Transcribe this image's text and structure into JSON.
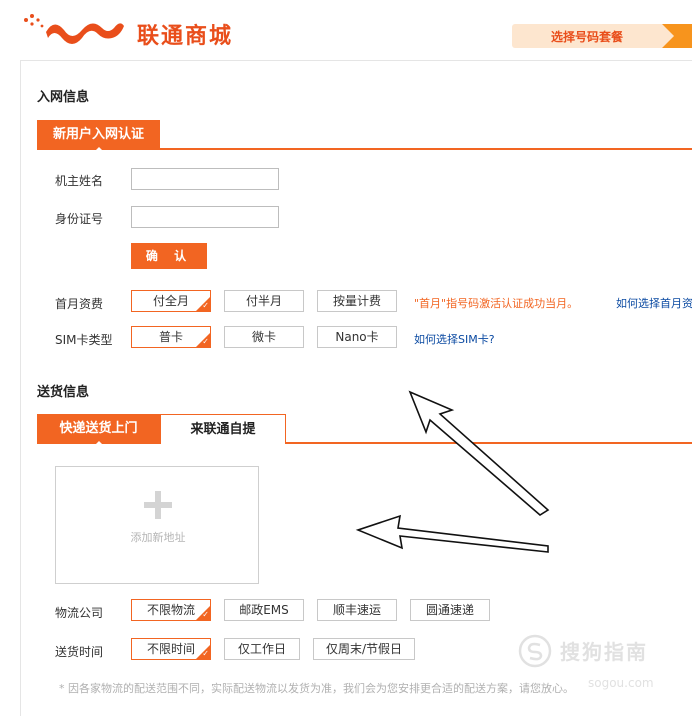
{
  "header": {
    "logo_text": "联通商城",
    "step_label": "选择号码套餐",
    "brand_color": "#e94e1b"
  },
  "network_section": {
    "title": "入网信息",
    "tab_label": "新用户入网认证",
    "owner_name_label": "机主姓名",
    "owner_name_value": "",
    "id_number_label": "身份证号",
    "id_number_value": "",
    "confirm_label": "确 认",
    "first_month_label": "首月资费",
    "first_month_options": [
      "付全月",
      "付半月",
      "按量计费"
    ],
    "first_month_selected": "付全月",
    "first_month_note": "\"首月\"指号码激活认证成功当月。",
    "first_month_help": "如何选择首月资",
    "sim_label": "SIM卡类型",
    "sim_options": [
      "普卡",
      "微卡",
      "Nano卡"
    ],
    "sim_selected": "普卡",
    "sim_help": "如何选择SIM卡?"
  },
  "delivery_section": {
    "title": "送货信息",
    "tabs": [
      "快递送货上门",
      "来联通自提"
    ],
    "active_tab": "快递送货上门",
    "add_address_label": "添加新地址",
    "logistics_label": "物流公司",
    "logistics_options": [
      "不限物流",
      "邮政EMS",
      "顺丰速运",
      "圆通速递"
    ],
    "logistics_selected": "不限物流",
    "delivery_time_label": "送货时间",
    "delivery_time_options": [
      "不限时间",
      "仅工作日",
      "仅周末/节假日"
    ],
    "delivery_time_selected": "不限时间",
    "footnote": "* 因各家物流的配送范围不同，实际配送物流以发货为准，我们会为您安排更合适的配送方案，请您放心。"
  },
  "watermark": {
    "text": "搜狗指南",
    "sub": "sogou.com"
  },
  "colors": {
    "accent": "#f26522",
    "link": "#0b4aa2",
    "step_bg": "#fde6cf"
  }
}
